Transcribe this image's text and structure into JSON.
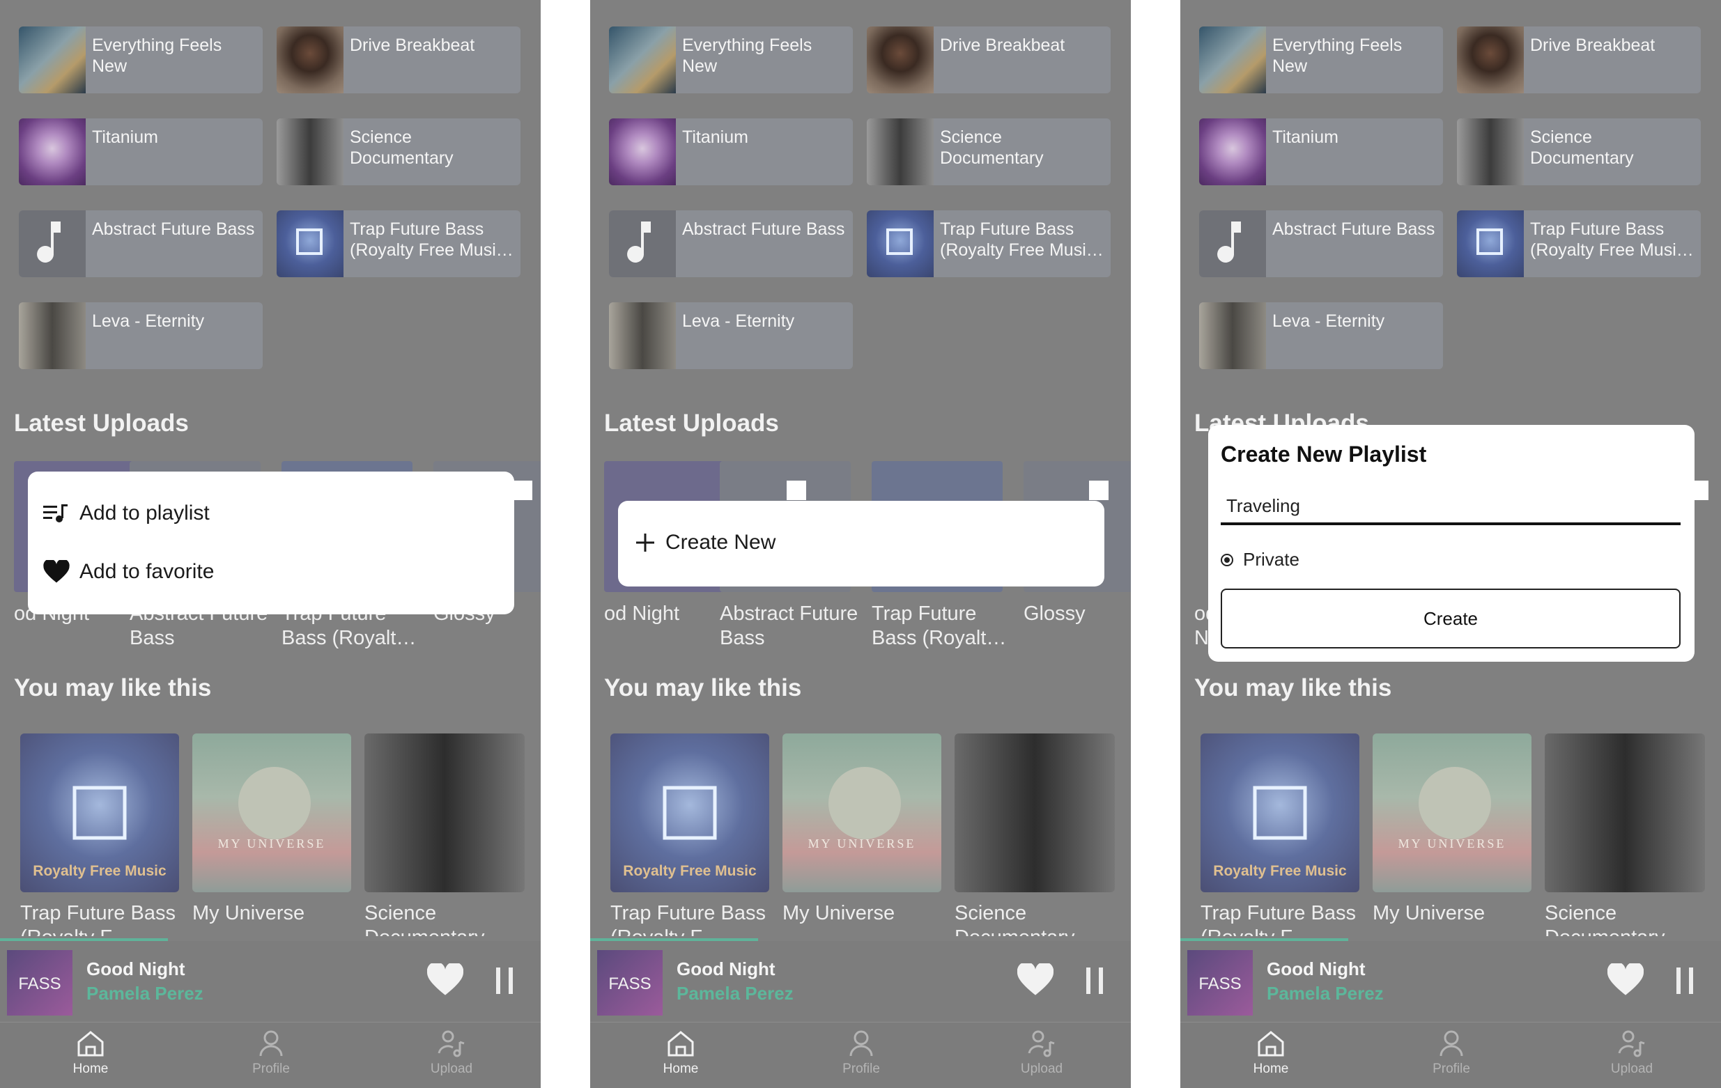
{
  "recent": [
    {
      "title": "Everything Feels New"
    },
    {
      "title": "Drive Breakbeat"
    },
    {
      "title": "Titanium"
    },
    {
      "title": "Science Documentary"
    },
    {
      "title": "Abstract Future Bass"
    },
    {
      "title": "Trap Future Bass (Royalty Free Musi…"
    },
    {
      "title": "Leva - Eternity"
    }
  ],
  "art_text": {
    "royalty": "Royalty Free Music",
    "universe": "MY UNIVERSE",
    "fass": "FASS"
  },
  "latest_uploads": {
    "title": "Latest Uploads",
    "items": [
      {
        "label": "od Night"
      },
      {
        "label": "Abstract Future Bass"
      },
      {
        "label": "Trap Future Bass (Royalt…"
      },
      {
        "label": "Glossy"
      }
    ]
  },
  "you_may_like": {
    "title": "You may like this",
    "items": [
      {
        "label": "Trap Future Bass (Royalty F…"
      },
      {
        "label": "My Universe"
      },
      {
        "label": "Science Documentary"
      }
    ]
  },
  "now_playing": {
    "title": "Good Night",
    "artist": "Pamela Perez",
    "progress": 0.31
  },
  "nav": {
    "home": "Home",
    "profile": "Profile",
    "upload": "Upload"
  },
  "menu": {
    "add_to_playlist": "Add to playlist",
    "add_to_favorite": "Add to favorite"
  },
  "create_new": {
    "label": "Create New"
  },
  "dialog": {
    "title": "Create New Playlist",
    "input_value": "Traveling",
    "privacy": "Private",
    "button": "Create"
  },
  "colors": {
    "overlay": "#808080",
    "accent": "#5cb79b",
    "card": "#8b8e94"
  }
}
